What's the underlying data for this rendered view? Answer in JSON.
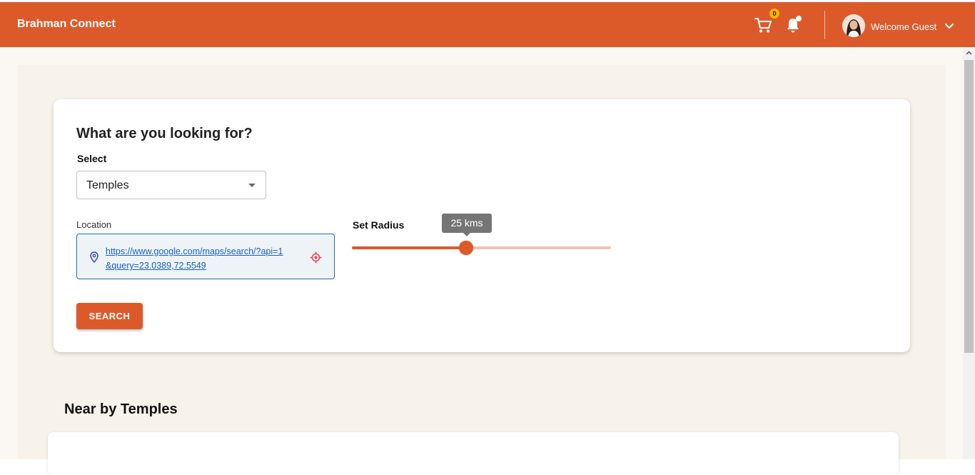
{
  "header": {
    "brand": "Brahman Connect",
    "cart_count": "0",
    "welcome_text": "Welcome Guest",
    "icons": [
      "cart-icon",
      "bell-icon",
      "avatar",
      "chevron-down-icon"
    ],
    "accent_color": "#dc5a2a"
  },
  "search_card": {
    "title": "What are you looking for?",
    "select_label": "Select",
    "select_value": "Temples",
    "location_label": "Location",
    "location_value": "https://www.google.com/maps/search/?api=1&query=23.0389,72.5549",
    "radius_label": "Set Radius",
    "radius_tooltip": "25 kms",
    "radius_fraction": 0.44,
    "search_button": "SEARCH"
  },
  "results": {
    "title": "Near by Temples"
  }
}
